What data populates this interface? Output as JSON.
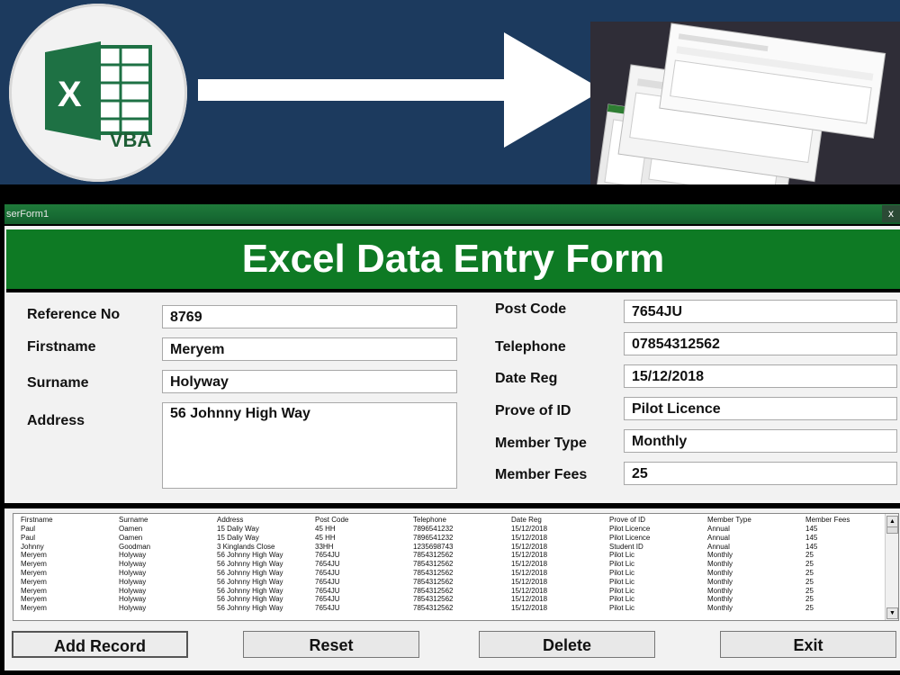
{
  "window": {
    "title": "serForm1",
    "close": "x"
  },
  "banner": {
    "logo_letter": "X",
    "logo_text": "VBA"
  },
  "form": {
    "header_title": "Excel Data Entry Form",
    "fields": {
      "reference_no": {
        "label": "Reference No",
        "value": "8769"
      },
      "firstname": {
        "label": "Firstname",
        "value": "Meryem"
      },
      "surname": {
        "label": "Surname",
        "value": "Holyway"
      },
      "address": {
        "label": "Address",
        "value": "56 Johnny High Way"
      },
      "post_code": {
        "label": "Post Code",
        "value": "7654JU"
      },
      "telephone": {
        "label": "Telephone",
        "value": "07854312562"
      },
      "date_reg": {
        "label": "Date Reg",
        "value": "15/12/2018"
      },
      "prove_of_id": {
        "label": "Prove of ID",
        "value": "Pilot Licence"
      },
      "member_type": {
        "label": "Member Type",
        "value": "Monthly"
      },
      "member_fees": {
        "label": "Member Fees",
        "value": "25"
      }
    }
  },
  "listbox": {
    "columns": [
      "Firstname",
      "Surname",
      "Address",
      "Post Code",
      "Telephone",
      "Date Reg",
      "Prove of ID",
      "Member Type",
      "Member Fees"
    ],
    "rows": [
      [
        "Paul",
        "Oamen",
        "15 Daliy Way",
        "45 HH",
        "7896541232",
        "15/12/2018",
        "Pilot Licence",
        "Annual",
        "145"
      ],
      [
        "Paul",
        "Oamen",
        "15 Daliy Way",
        "45 HH",
        "7896541232",
        "15/12/2018",
        "Pilot Licence",
        "Annual",
        "145"
      ],
      [
        "Johnny",
        "Goodman",
        "3 Kinglands Close",
        "33HH",
        "1235698743",
        "15/12/2018",
        "Student ID",
        "Annual",
        "145"
      ],
      [
        "Meryem",
        "Holyway",
        "56 Johnny High Way",
        "7654JU",
        "7854312562",
        "15/12/2018",
        "Pilot Lic",
        "Monthly",
        "25"
      ],
      [
        "Meryem",
        "Holyway",
        "56 Johnny High Way",
        "7654JU",
        "7854312562",
        "15/12/2018",
        "Pilot Lic",
        "Monthly",
        "25"
      ],
      [
        "Meryem",
        "Holyway",
        "56 Johnny High Way",
        "7654JU",
        "7854312562",
        "15/12/2018",
        "Pilot Lic",
        "Monthly",
        "25"
      ],
      [
        "Meryem",
        "Holyway",
        "56 Johnny High Way",
        "7654JU",
        "7854312562",
        "15/12/2018",
        "Pilot Lic",
        "Monthly",
        "25"
      ],
      [
        "Meryem",
        "Holyway",
        "56 Johnny High Way",
        "7654JU",
        "7854312562",
        "15/12/2018",
        "Pilot Lic",
        "Monthly",
        "25"
      ],
      [
        "Meryem",
        "Holyway",
        "56 Johnny High Way",
        "7654JU",
        "7854312562",
        "15/12/2018",
        "Pilot Lic",
        "Monthly",
        "25"
      ],
      [
        "Meryem",
        "Holyway",
        "56 Johnny High Way",
        "7654JU",
        "7854312562",
        "15/12/2018",
        "Pilot Lic",
        "Monthly",
        "25"
      ]
    ],
    "scroll_up": "▲",
    "scroll_down": "▼"
  },
  "buttons": {
    "add_record": "Add Record",
    "reset": "Reset",
    "delete": "Delete",
    "exit": "Exit"
  },
  "colors": {
    "banner_bg": "#1c3a5e",
    "header_green": "#0e7a24",
    "excel_green": "#1e7144"
  }
}
